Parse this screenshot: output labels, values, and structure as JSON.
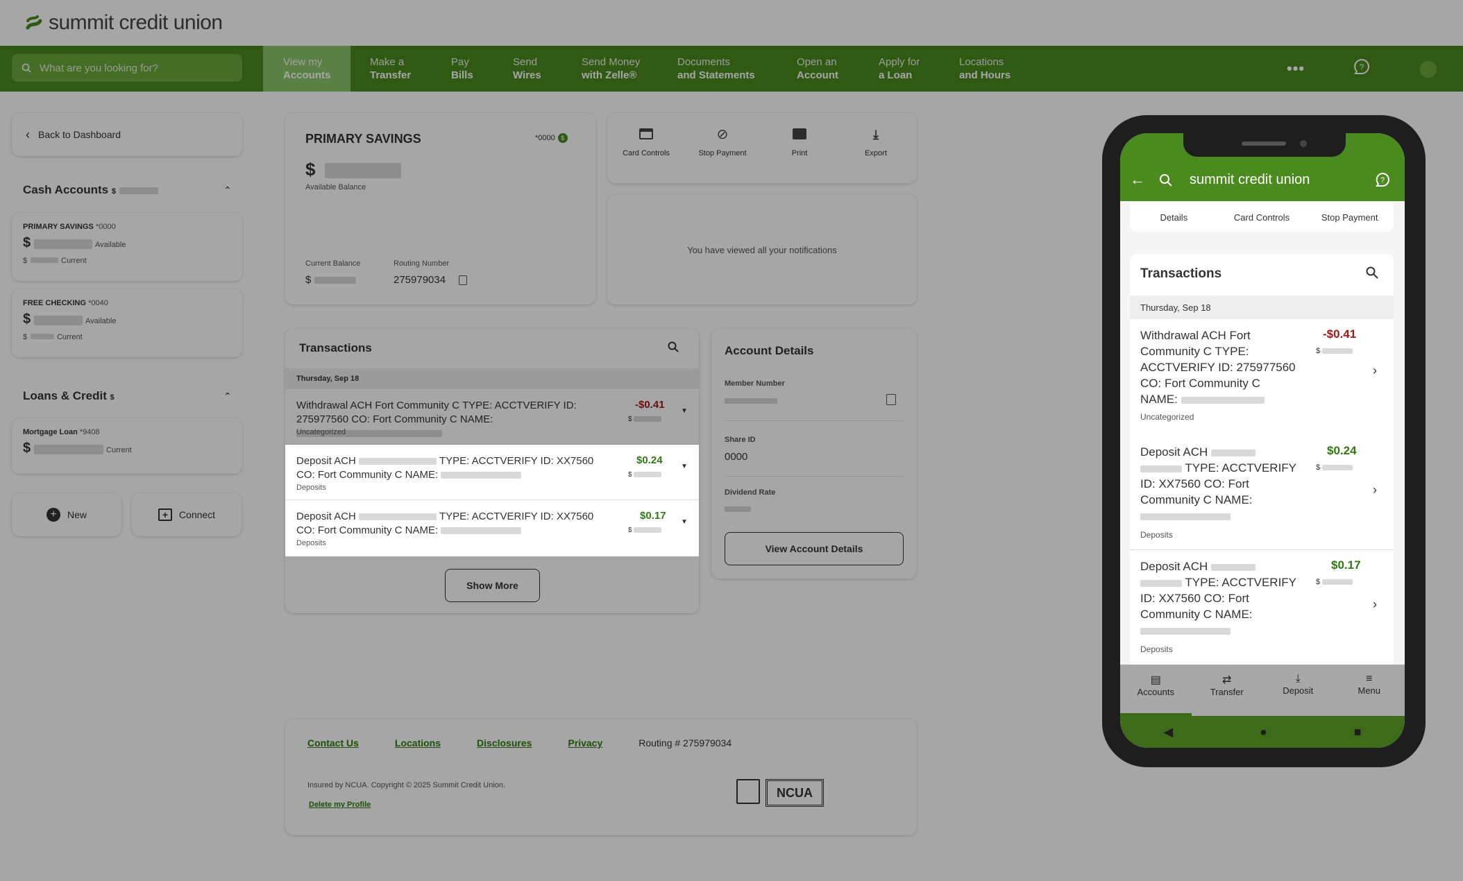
{
  "logo": {
    "text": "summit credit union"
  },
  "search": {
    "placeholder": "What are you looking for?"
  },
  "nav": [
    {
      "l1": "View my",
      "l2": "Accounts"
    },
    {
      "l1": "Make a",
      "l2": "Transfer"
    },
    {
      "l1": "Pay",
      "l2": "Bills"
    },
    {
      "l1": "Send",
      "l2": "Wires"
    },
    {
      "l1": "Send Money",
      "l2": "with Zelle®"
    },
    {
      "l1": "Documents",
      "l2": "and Statements"
    },
    {
      "l1": "Open an",
      "l2": "Account"
    },
    {
      "l1": "Apply for",
      "l2": "a Loan"
    },
    {
      "l1": "Locations",
      "l2": "and Hours"
    }
  ],
  "sidebar": {
    "back": "Back to Dashboard",
    "cash_title": "Cash Accounts",
    "cash_dollar": "$",
    "accounts": [
      {
        "name": "PRIMARY SAVINGS",
        "num": "*0000",
        "dollar": "$",
        "available": "Available",
        "dollar2": "$",
        "current": "Current"
      },
      {
        "name": "FREE CHECKING",
        "num": "*0040",
        "dollar": "$",
        "available": "Available",
        "dollar2": "$",
        "current": "Current"
      }
    ],
    "loans_title": "Loans & Credit",
    "loans_dollar": "$",
    "loan": {
      "name": "Mortgage Loan",
      "num": "*9408",
      "dollar": "$",
      "current": "Current"
    },
    "new_label": "New",
    "connect_label": "Connect"
  },
  "account": {
    "title": "PRIMARY SAVINGS",
    "num": "*0000",
    "dollar": "$",
    "available": "Available Balance",
    "current_label": "Current Balance",
    "current_dollar": "$",
    "routing_label": "Routing Number",
    "routing": "275979034"
  },
  "actions": [
    "Card Controls",
    "Stop Payment",
    "Print",
    "Export"
  ],
  "notifications": "You have viewed all your notifications",
  "transactions": {
    "title": "Transactions",
    "date": "Thursday, Sep 18",
    "items": [
      {
        "l1": "Withdrawal ACH Fort Community C TYPE: ACCTVERIFY ID:",
        "l2": "275977560 CO: Fort Community C NAME:",
        "cat": "Uncategorized",
        "amount": "-$0.41",
        "dollar": "$"
      },
      {
        "l1a": "Deposit ACH",
        "l1b": "TYPE: ACCTVERIFY ID: XX7560",
        "l2": "CO: Fort Community C NAME:",
        "cat": "Deposits",
        "amount": "$0.24",
        "dollar": "$"
      },
      {
        "l1a": "Deposit ACH",
        "l1b": "TYPE: ACCTVERIFY ID: XX7560",
        "l2": "CO: Fort Community C NAME:",
        "cat": "Deposits",
        "amount": "$0.17",
        "dollar": "$"
      }
    ],
    "show_more": "Show More"
  },
  "details": {
    "title": "Account Details",
    "member_label": "Member Number",
    "share_label": "Share ID",
    "share": "0000",
    "dividend_label": "Dividend Rate",
    "button": "View Account Details"
  },
  "footer": {
    "links": [
      "Contact Us",
      "Locations",
      "Disclosures",
      "Privacy"
    ],
    "routing": "Routing # 275979034",
    "copyright": "Insured by NCUA. Copyright © 2025 Summit Credit Union.",
    "delete": "Delete my Profile",
    "ncua": "NCUA"
  },
  "phone": {
    "brand": "summit credit union",
    "tabs_top": [
      "Details",
      "Card Controls",
      "Stop Payment"
    ],
    "tx_title": "Transactions",
    "date": "Thursday, Sep 18",
    "items": [
      {
        "lines": [
          "Withdrawal ACH Fort",
          "Community C TYPE:",
          "ACCTVERIFY ID: 275977560",
          "CO: Fort Community C",
          "NAME:"
        ],
        "cat": "Uncategorized",
        "amount": "-$0.41",
        "dollar": "$"
      },
      {
        "lines": [
          "Deposit ACH",
          "",
          "TYPE: ACCTVERIFY",
          "ID: XX7560 CO: Fort",
          "Community C NAME:"
        ],
        "cat": "Deposits",
        "amount": "$0.24",
        "dollar": "$"
      },
      {
        "lines": [
          "Deposit ACH",
          "",
          "TYPE: ACCTVERIFY",
          "ID: XX7560 CO: Fort",
          "Community C NAME:"
        ],
        "cat": "Deposits",
        "amount": "$0.17",
        "dollar": "$"
      }
    ],
    "bottom_nav": [
      "Accounts",
      "Transfer",
      "Deposit",
      "Menu"
    ]
  }
}
